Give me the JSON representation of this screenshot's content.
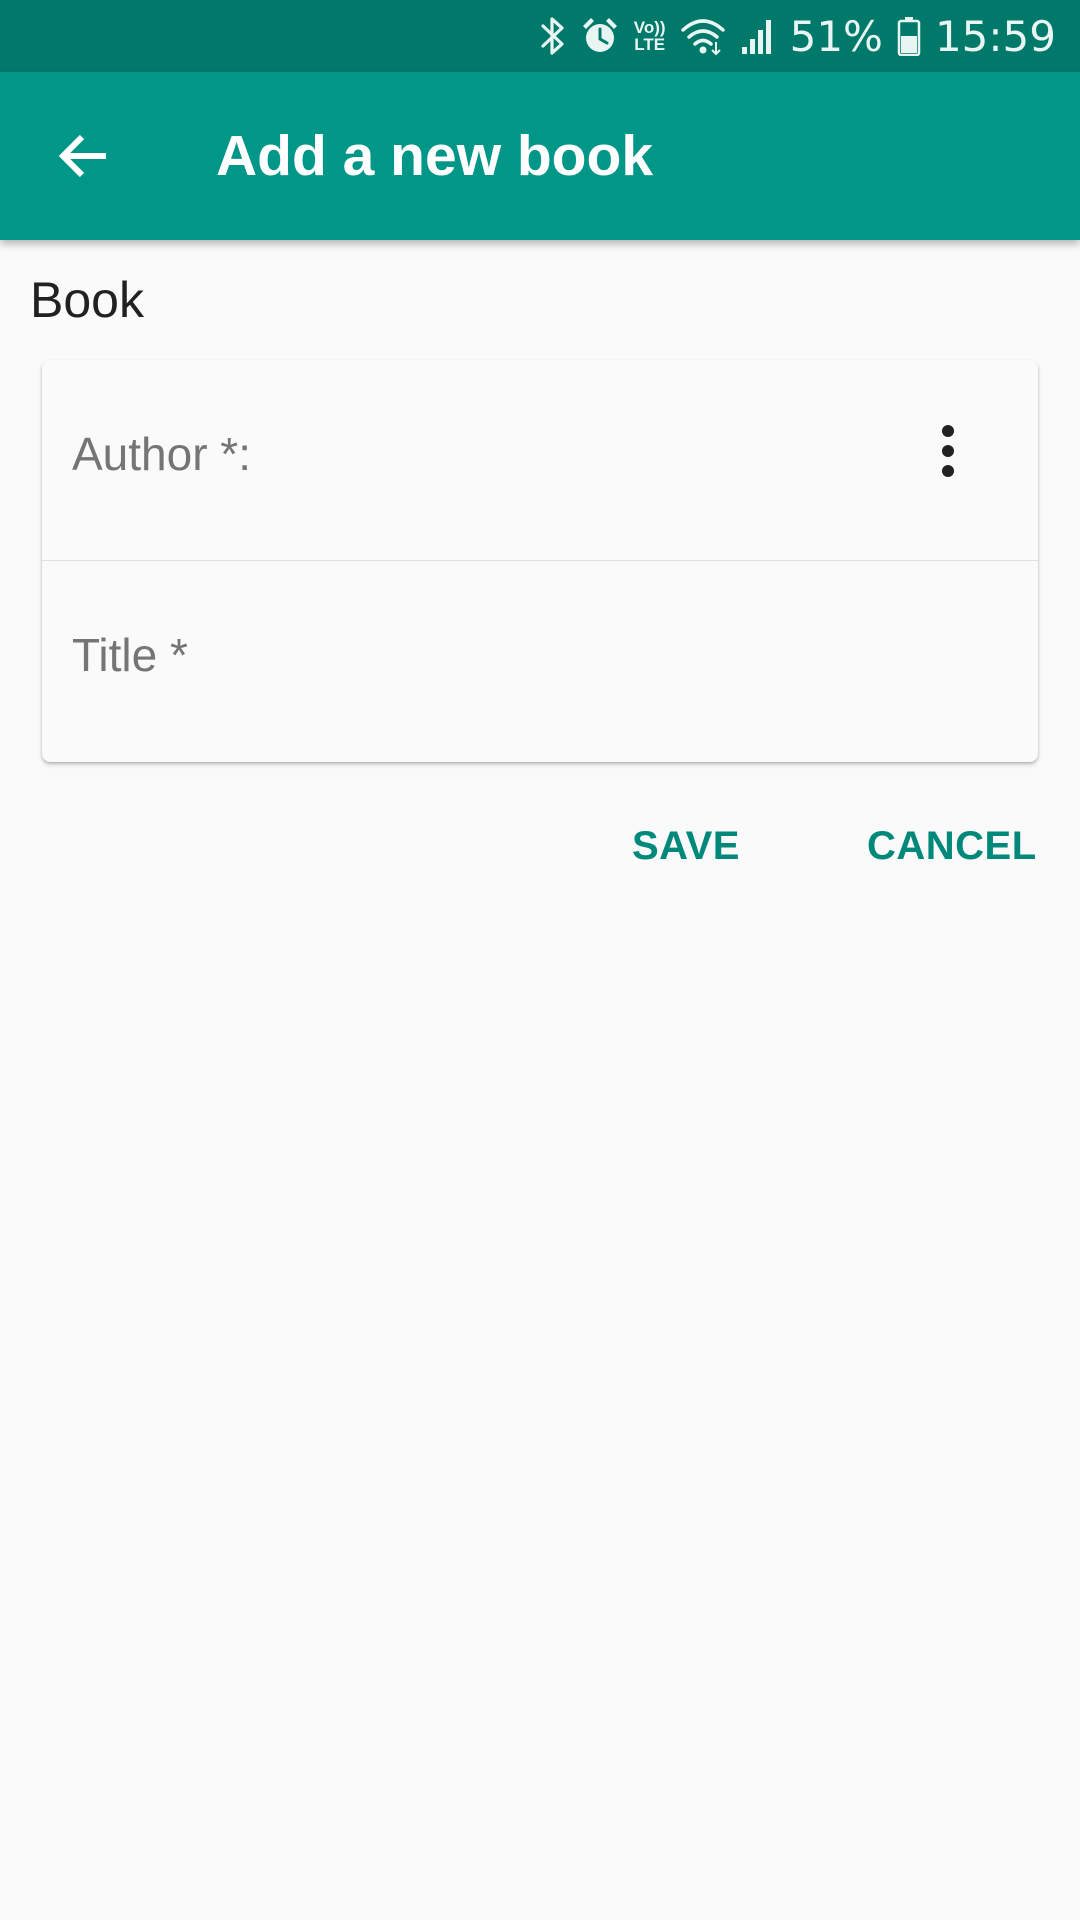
{
  "status_bar": {
    "battery_percent": "51%",
    "time": "15:59",
    "volte_top": "Vo))",
    "volte_bottom": "LTE",
    "icons": [
      "bluetooth-icon",
      "alarm-icon",
      "volte-icon",
      "wifi-icon",
      "signal-icon",
      "battery-icon"
    ]
  },
  "app_bar": {
    "title": "Add a new book",
    "back_icon": "arrow-back-icon"
  },
  "section": {
    "label": "Book"
  },
  "form": {
    "author_label": "Author *:",
    "title_label": "Title *",
    "more_icon": "more-vert-icon"
  },
  "actions": {
    "save_label": "SAVE",
    "cancel_label": "CANCEL"
  },
  "colors": {
    "status_bar": "#00796b",
    "app_bar": "#009688",
    "accent": "#00897b",
    "background": "#fafafa"
  }
}
